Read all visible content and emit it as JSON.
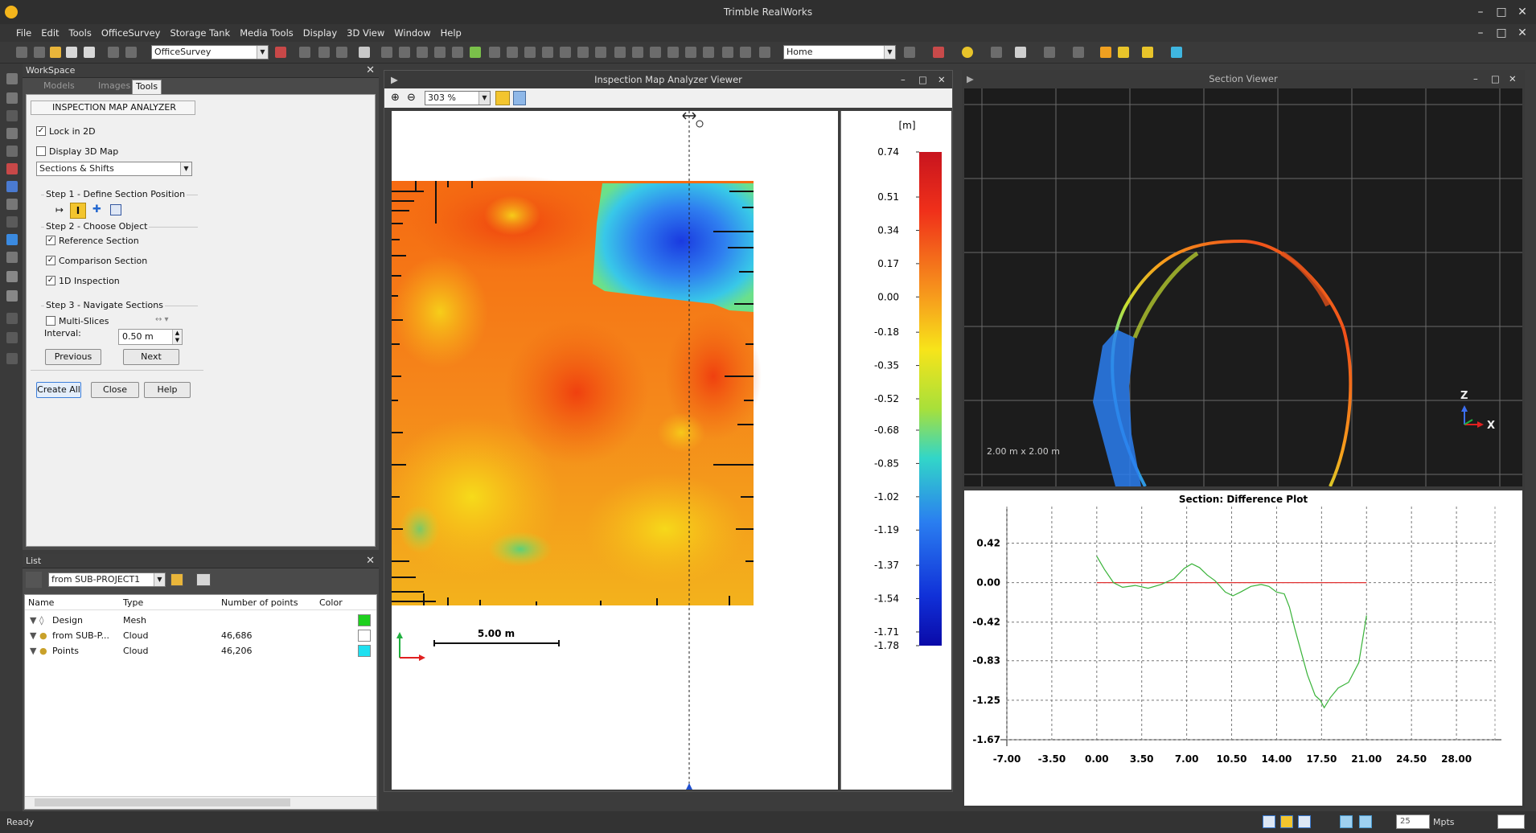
{
  "app": {
    "title": "Trimble RealWorks"
  },
  "menu": [
    "File",
    "Edit",
    "Tools",
    "OfficeSurvey",
    "Storage Tank",
    "Media Tools",
    "Display",
    "3D View",
    "Window",
    "Help"
  ],
  "toolbar": {
    "mode_combo": "OfficeSurvey",
    "view_combo": "Home"
  },
  "workspace": {
    "title": "WorkSpace",
    "tabs": [
      "Models",
      "Images",
      "Tools"
    ],
    "tool_title": "INSPECTION MAP ANALYZER",
    "lock_2d": "Lock in 2D",
    "display_3d": "Display 3D Map",
    "mode_select": "Sections & Shifts",
    "step1": "Step 1 - Define Section Position",
    "step2": "Step 2 - Choose Object",
    "ref_section": "Reference Section",
    "cmp_section": "Comparison Section",
    "insp_1d": "1D Inspection",
    "step3": "Step 3 - Navigate Sections",
    "multi_slices": "Multi-Slices",
    "interval_label": "Interval:",
    "interval_value": "0.50 m",
    "previous": "Previous",
    "next": "Next",
    "create_all": "Create All",
    "close": "Close",
    "help": "Help"
  },
  "list": {
    "title": "List",
    "filter": "from SUB-PROJECT1",
    "columns": [
      "Name",
      "Type",
      "Number of points",
      "Color"
    ],
    "rows": [
      {
        "name": "Design",
        "type": "Mesh",
        "points": "",
        "color": "#1ed01e"
      },
      {
        "name": "from SUB-P...",
        "type": "Cloud",
        "points": "46,686",
        "color": "#ffffff"
      },
      {
        "name": "Points",
        "type": "Cloud",
        "points": "46,206",
        "color": "#1ee0f0"
      }
    ]
  },
  "inspection": {
    "title": "Inspection Map Analyzer Viewer",
    "zoom": "303 %",
    "scale_label": "5.00 m",
    "legend_unit": "[m]",
    "legend_ticks": [
      "0.74",
      "0.51",
      "0.34",
      "0.17",
      "0.00",
      "-0.18",
      "-0.35",
      "-0.52",
      "-0.68",
      "-0.85",
      "-1.02",
      "-1.19",
      "-1.37",
      "-1.54",
      "-1.71",
      "-1.78"
    ]
  },
  "section": {
    "title": "Section Viewer",
    "grid_label": "2.00 m x 2.00 m",
    "axis_z": "Z",
    "axis_x": "X"
  },
  "chart_data": {
    "type": "line",
    "title": "Section: Difference Plot",
    "xlabel": "",
    "ylabel": "",
    "xticks": [
      "-7.00",
      "-3.50",
      "0.00",
      "3.50",
      "7.00",
      "10.50",
      "14.00",
      "17.50",
      "21.00",
      "24.50",
      "28.00"
    ],
    "yticks": [
      "0.42",
      "0.00",
      "-0.42",
      "-0.83",
      "-1.25",
      "-1.67"
    ],
    "xlim": [
      -7,
      31
    ],
    "ylim": [
      -1.67,
      0.74
    ],
    "grid": true,
    "series": [
      {
        "color": "#e03030",
        "x": [
          0,
          21
        ],
        "y": [
          0,
          0
        ]
      },
      {
        "color": "#39b339",
        "x": [
          0,
          0.6,
          1.3,
          2.0,
          3.0,
          4.0,
          5.0,
          6.0,
          6.8,
          7.4,
          8.0,
          8.6,
          9.2,
          10.0,
          10.6,
          11.2,
          12.0,
          12.8,
          13.4,
          14.0,
          14.6,
          15.0,
          15.4,
          15.8,
          16.4,
          17.0,
          17.4,
          17.7,
          18.2,
          18.8,
          19.6,
          20.4,
          21.0
        ],
        "y": [
          0.28,
          0.14,
          0.0,
          -0.05,
          -0.03,
          -0.06,
          -0.02,
          0.04,
          0.15,
          0.2,
          0.16,
          0.08,
          0.02,
          -0.1,
          -0.14,
          -0.1,
          -0.04,
          -0.02,
          -0.04,
          -0.1,
          -0.12,
          -0.26,
          -0.48,
          -0.68,
          -0.98,
          -1.2,
          -1.25,
          -1.33,
          -1.22,
          -1.12,
          -1.06,
          -0.85,
          -0.35
        ]
      }
    ]
  },
  "status": {
    "text": "Ready",
    "mpts_value": "25",
    "mpts_label": "Mpts"
  }
}
